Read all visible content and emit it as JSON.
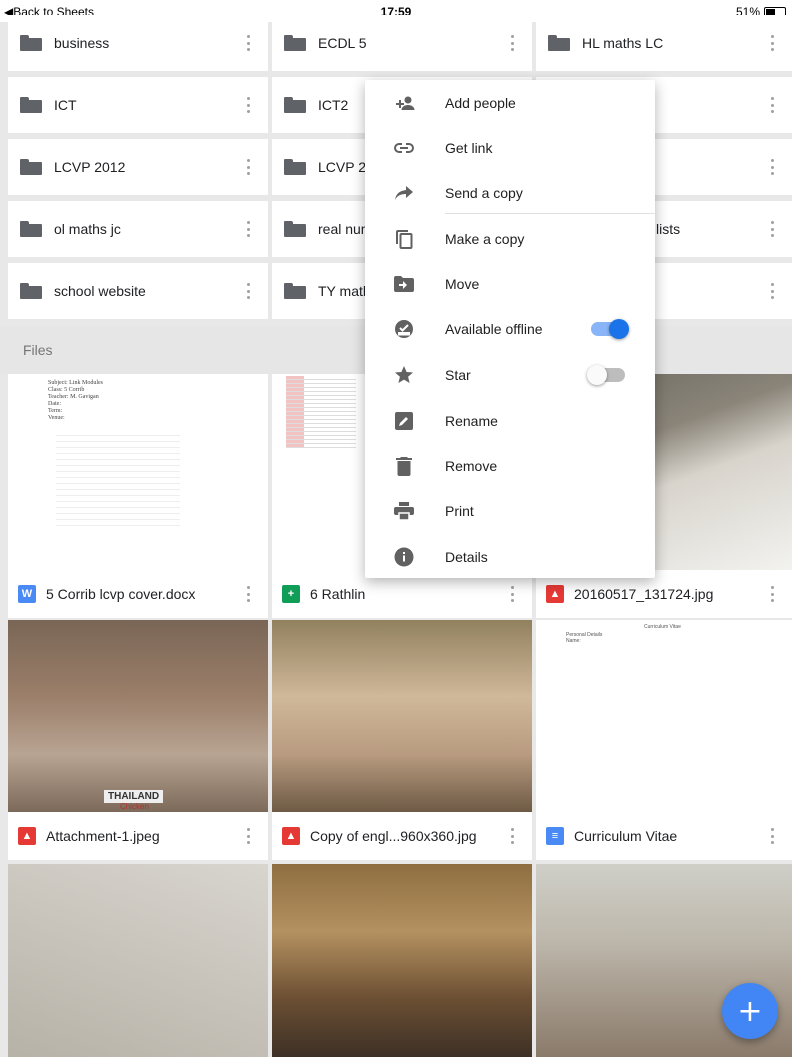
{
  "status_bar": {
    "back_label": "Back to Sheets",
    "time": "17:59",
    "battery": "51%",
    "battery_fraction": 0.51
  },
  "folders": [
    {
      "label": "business"
    },
    {
      "label": "ECDL 5"
    },
    {
      "label": "HL maths LC"
    },
    {
      "label": "ICT"
    },
    {
      "label": "ICT2"
    },
    {
      "label": "LCVP 2012"
    },
    {
      "label": "LCVP 20"
    },
    {
      "label": "ol maths jc"
    },
    {
      "label": "real num"
    },
    {
      "label": "lists"
    },
    {
      "label": "school website"
    },
    {
      "label": "TY math"
    }
  ],
  "files_section_label": "Files",
  "files": [
    {
      "label": "5 Corrib lcvp cover.docx",
      "type_letter": "W"
    },
    {
      "label": "6 Rathlin"
    },
    {
      "label": "20160517_131724.jpg"
    },
    {
      "label": "Attachment-1.jpeg"
    },
    {
      "label": "Copy of engl...960x360.jpg"
    },
    {
      "label": "Curriculum Vitae"
    }
  ],
  "thumb_text": {
    "doc_header": "Subject: Link Modules\nClass: 5 Corrib\nTeacher: M. Gavigan\nDate:\nTerm:\nVenue:",
    "cv_title": "Curriculum Vitae",
    "cv_sub": "Personal Details\nName:",
    "thailand": "THAILAND",
    "chicken": "Chicken"
  },
  "context_menu": {
    "items": [
      {
        "label": "Add people",
        "icon": "add-person-icon"
      },
      {
        "label": "Get link",
        "icon": "link-icon"
      },
      {
        "label": "Send a copy",
        "icon": "share-arrow-icon"
      },
      {
        "label": "Make a copy",
        "icon": "copy-icon"
      },
      {
        "label": "Move",
        "icon": "move-folder-icon"
      },
      {
        "label": "Available offline",
        "icon": "offline-check-icon",
        "toggle": true
      },
      {
        "label": "Star",
        "icon": "star-icon",
        "toggle": false
      },
      {
        "label": "Rename",
        "icon": "rename-icon"
      },
      {
        "label": "Remove",
        "icon": "trash-icon"
      },
      {
        "label": "Print",
        "icon": "print-icon"
      },
      {
        "label": "Details",
        "icon": "info-icon"
      }
    ]
  },
  "fab": {
    "label": "+"
  },
  "colors": {
    "accent": "#4285f4",
    "toggle_on": "#1a73e8",
    "image_type": "#e53935",
    "sheet_type": "#0f9d58",
    "doc_type": "#4a8af4"
  }
}
